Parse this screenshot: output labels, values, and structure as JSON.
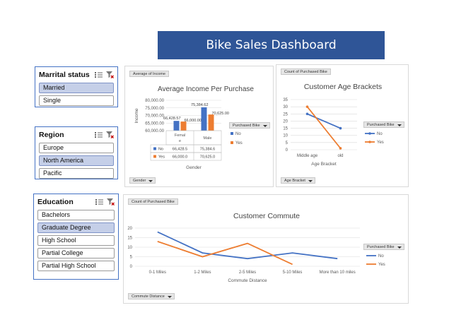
{
  "dashboard": {
    "title": "Bike Sales Dashboard"
  },
  "slicers": {
    "marital": {
      "title": "Marrital status",
      "items": [
        "Married",
        "Single"
      ],
      "selected": [
        "Married"
      ]
    },
    "region": {
      "title": "Region",
      "items": [
        "Europe",
        "North America",
        "Pacific"
      ],
      "selected": [
        "North America"
      ]
    },
    "education": {
      "title": "Education",
      "items": [
        "Bachelors",
        "Graduate Degree",
        "High School",
        "Partial College",
        "Partial High School"
      ],
      "selected": [
        "Graduate Degree"
      ]
    }
  },
  "colors": {
    "series_no": "#4472c4",
    "series_yes": "#ed7d31",
    "banner": "#2f5597",
    "slicer_selected": "#c5cfe8"
  },
  "income_chart": {
    "value_button": "Average of Income",
    "axis_button": "Gender",
    "legend_button": "Purchased Bike",
    "legend": [
      "No",
      "Yes"
    ],
    "table": {
      "rows": [
        {
          "label": "No",
          "values": [
            "66,428.5",
            "75,384.6"
          ]
        },
        {
          "label": "Yes",
          "values": [
            "66,000.0",
            "70,625.0"
          ]
        }
      ]
    },
    "chart_data": {
      "type": "bar",
      "title": "Average Income Per Purchase",
      "xlabel": "Gender",
      "ylabel": "Income",
      "categories": [
        "Female",
        "Male"
      ],
      "series": [
        {
          "name": "No",
          "values": [
            66428.5,
            75384.62
          ]
        },
        {
          "name": "Yes",
          "values": [
            66000.0,
            70625.0
          ]
        }
      ],
      "data_labels": [
        [
          "66,428.57",
          "75,384.62"
        ],
        [
          "66,000.00",
          "70,625.00"
        ]
      ],
      "ylim": [
        60000,
        80000
      ],
      "yticks": [
        "60,000.00",
        "65,000.00",
        "70,000.00",
        "75,000.00",
        "80,000.00"
      ],
      "yticks_values": [
        60000,
        65000,
        70000,
        75000,
        80000
      ],
      "grid": true,
      "legend": "right"
    }
  },
  "age_chart": {
    "value_button": "Count of Purchased Bike",
    "axis_button": "Age Bracket",
    "legend_button": "Purchased Bike",
    "legend": [
      "No",
      "Yes"
    ],
    "chart_data": {
      "type": "line",
      "title": "Customer Age Brackets",
      "xlabel": "Age Bracket",
      "ylabel": "",
      "categories": [
        "Middle age",
        "old"
      ],
      "series": [
        {
          "name": "No",
          "values": [
            25,
            15
          ]
        },
        {
          "name": "Yes",
          "values": [
            30,
            1
          ]
        }
      ],
      "ylim": [
        0,
        35
      ],
      "yticks": [
        0,
        5,
        10,
        15,
        20,
        25,
        30,
        35
      ],
      "grid": true,
      "legend": "right"
    }
  },
  "commute_chart": {
    "value_button": "Count of Purchased Bike",
    "axis_button": "Commute Distance",
    "legend_button": "Purchased Bike",
    "legend": [
      "No",
      "Yes"
    ],
    "chart_data": {
      "type": "line",
      "title": "Customer Commute",
      "xlabel": "Commute Distance",
      "ylabel": "",
      "categories": [
        "0-1 Miles",
        "1-2 Miles",
        "2-5 Miles",
        "5-10 Miles",
        "More than 10 miles"
      ],
      "series": [
        {
          "name": "No",
          "values": [
            18,
            7,
            4,
            7,
            4
          ]
        },
        {
          "name": "Yes",
          "values": [
            13,
            5,
            12,
            1,
            null
          ]
        }
      ],
      "ylim": [
        0,
        20
      ],
      "yticks": [
        0,
        5,
        10,
        15,
        20
      ],
      "grid": true,
      "legend": "right"
    }
  }
}
